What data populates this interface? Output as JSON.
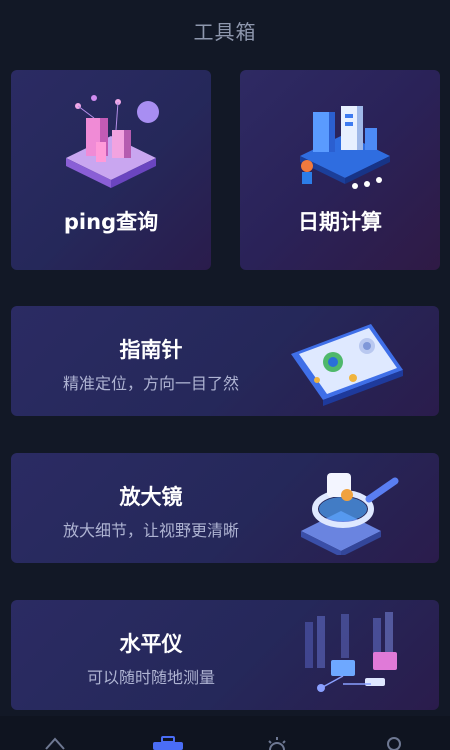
{
  "page": {
    "title": "工具箱"
  },
  "tools": {
    "ping": {
      "label": "ping查询"
    },
    "date": {
      "label": "日期计算"
    },
    "compass": {
      "title": "指南针",
      "subtitle": "精准定位，方向一目了然"
    },
    "magnifier": {
      "title": "放大镜",
      "subtitle": "放大细节，让视野更清晰"
    },
    "level": {
      "title": "水平仪",
      "subtitle": "可以随时随地测量"
    }
  },
  "tabbar": {
    "items": [
      {
        "icon": "home-icon"
      },
      {
        "icon": "toolbox-icon",
        "active": true
      },
      {
        "icon": "sun-icon"
      },
      {
        "icon": "user-icon"
      }
    ]
  },
  "colors": {
    "background": "#121826",
    "card": "#27295e",
    "accent": "#4a6df5",
    "subtitle": "#aeb3d2"
  }
}
